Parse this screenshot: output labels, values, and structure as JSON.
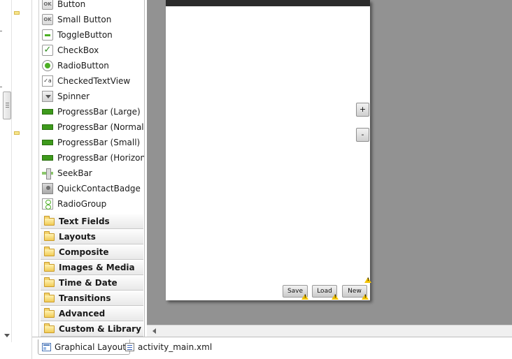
{
  "palette": {
    "widgets": [
      {
        "label": "Button",
        "icon": "button-icon"
      },
      {
        "label": "Small Button",
        "icon": "small-button-icon"
      },
      {
        "label": "ToggleButton",
        "icon": "toggle-button-icon"
      },
      {
        "label": "CheckBox",
        "icon": "checkbox-icon"
      },
      {
        "label": "RadioButton",
        "icon": "radio-button-icon"
      },
      {
        "label": "CheckedTextView",
        "icon": "checked-text-view-icon"
      },
      {
        "label": "Spinner",
        "icon": "spinner-icon"
      },
      {
        "label": "ProgressBar (Large)",
        "icon": "progress-bar-icon"
      },
      {
        "label": "ProgressBar (Normal)",
        "icon": "progress-bar-icon"
      },
      {
        "label": "ProgressBar (Small)",
        "icon": "progress-bar-icon"
      },
      {
        "label": "ProgressBar (Horizonta",
        "icon": "progress-bar-icon"
      },
      {
        "label": "SeekBar",
        "icon": "seekbar-icon"
      },
      {
        "label": "QuickContactBadge",
        "icon": "quick-contact-badge-icon"
      },
      {
        "label": "RadioGroup",
        "icon": "radio-group-icon"
      }
    ],
    "ok_glyph": "OK",
    "check_glyph": "✓",
    "checked_text_glyph": "✓a",
    "categories": [
      {
        "label": "Text Fields"
      },
      {
        "label": "Layouts"
      },
      {
        "label": "Composite"
      },
      {
        "label": "Images & Media"
      },
      {
        "label": "Time & Date"
      },
      {
        "label": "Transitions"
      },
      {
        "label": "Advanced"
      },
      {
        "label": "Custom & Library Vie"
      }
    ]
  },
  "canvas": {
    "zoom_in_label": "+",
    "zoom_out_label": "-",
    "buttons": [
      {
        "label": "Save"
      },
      {
        "label": "Load"
      },
      {
        "label": "New"
      }
    ]
  },
  "tabs": [
    {
      "label": "Graphical Layout",
      "active": true,
      "icon": "layout-icon"
    },
    {
      "label": "activity_main.xml",
      "active": false,
      "icon": "xml-file-icon"
    }
  ],
  "colors": {
    "canvas_bg": "#929292",
    "progress_green": "#3e9a1c",
    "warning_yellow": "#f2c200",
    "folder_yellow": "#f1cc55"
  }
}
